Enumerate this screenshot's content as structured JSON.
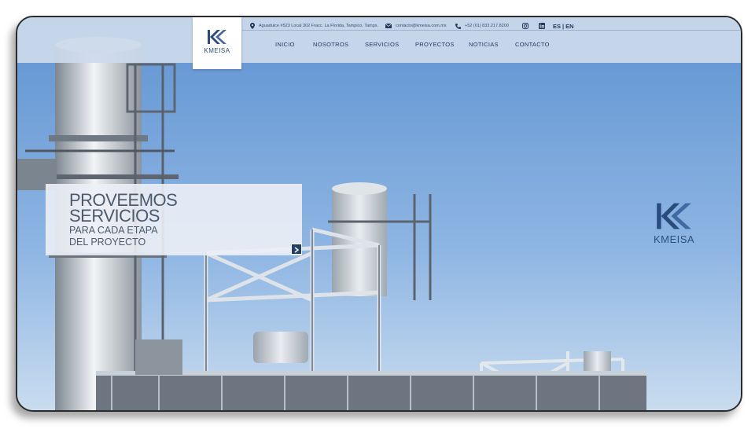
{
  "brand": {
    "name": "KMEISA"
  },
  "contact": {
    "address": "Aguadulce #523 Local 302 Fracc. La Florida, Tampico, Tamps.",
    "email": "contacto@kmeisa.com.mx",
    "phone": "+52 (01) 833.217.8200"
  },
  "languages": {
    "es": "ES",
    "separator": "|",
    "en": "EN"
  },
  "nav": {
    "inicio": "INICIO",
    "nosotros": "NOSOTROS",
    "servicios": "SERVICIOS",
    "proyectos": "PROYECTOS",
    "noticias": "NOTICIAS",
    "contacto": "CONTACTO"
  },
  "hero": {
    "line1": "PROVEEMOS",
    "line2": "SERVICIOS",
    "sub1": "PARA CADA ETAPA",
    "sub2": "DEL PROYECTO"
  },
  "icons": [
    "map-pin-icon",
    "mail-icon",
    "phone-icon",
    "instagram-icon",
    "linkedin-icon",
    "arrow-right-icon",
    "kmeisa-logo-icon"
  ],
  "colors": {
    "brand": "#1f3f6e",
    "sky": "#8fb6e3",
    "nav_text": "#243a5c"
  }
}
